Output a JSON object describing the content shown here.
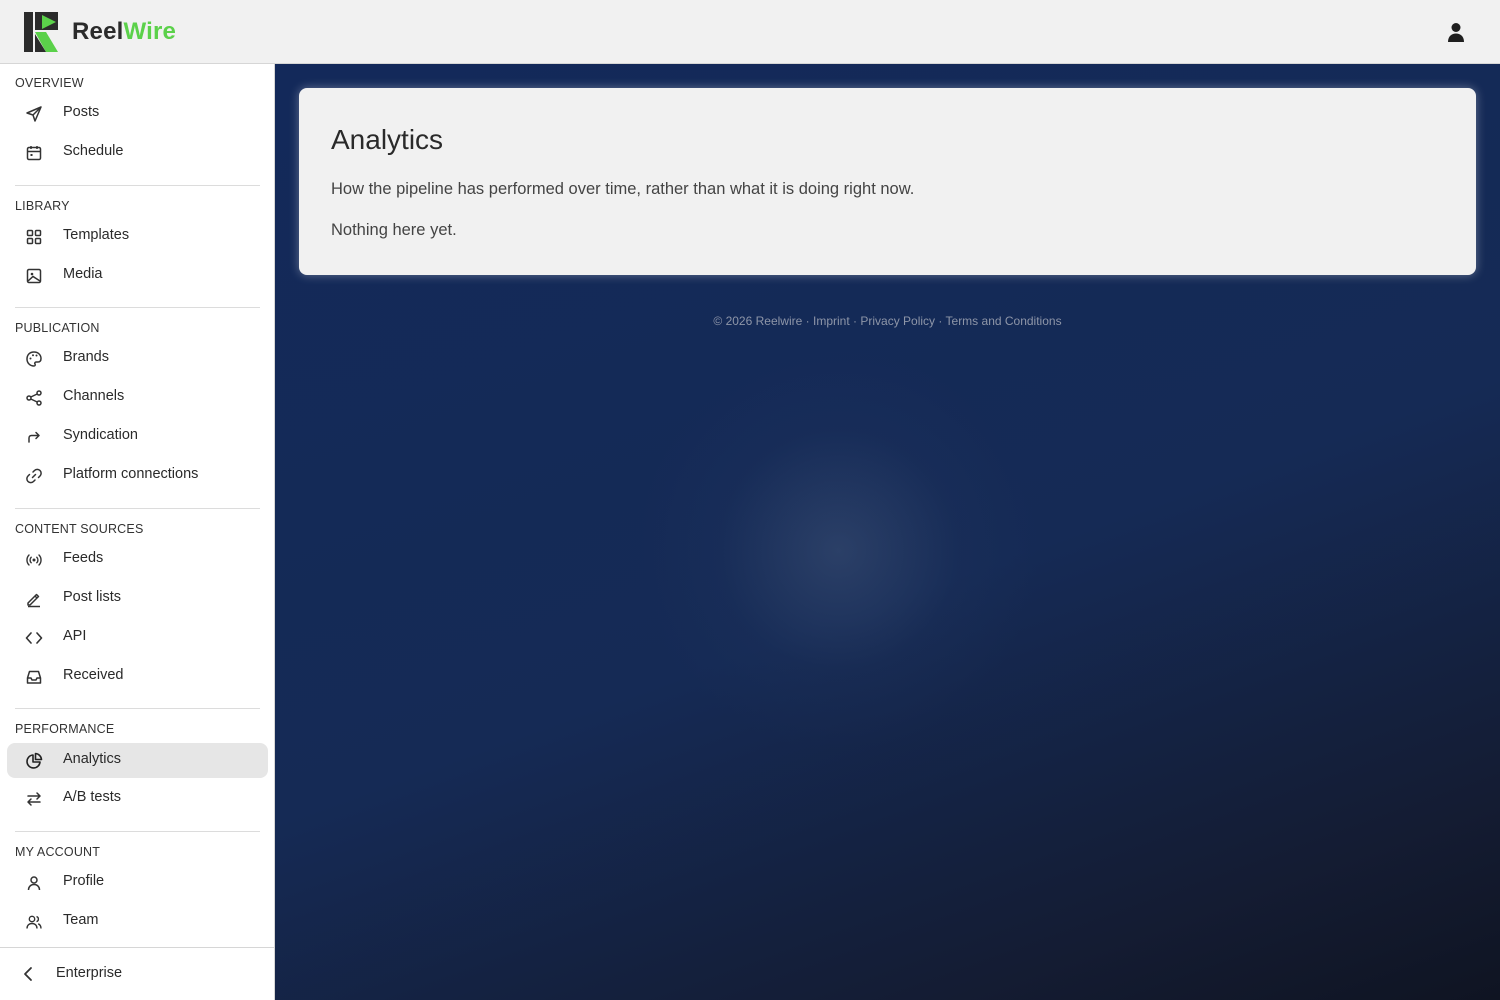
{
  "header": {
    "brand_part1": "Reel",
    "brand_part2": "Wire",
    "brand_colors": {
      "dark": "#2b2b2b",
      "green": "#5bd14a"
    },
    "user_icon": "user-icon"
  },
  "sidebar": {
    "sections": [
      {
        "title": "OVERVIEW",
        "items": [
          {
            "label": "Posts",
            "icon": "send-icon"
          },
          {
            "label": "Schedule",
            "icon": "calendar-icon"
          }
        ]
      },
      {
        "title": "LIBRARY",
        "items": [
          {
            "label": "Templates",
            "icon": "grid-icon"
          },
          {
            "label": "Media",
            "icon": "image-icon"
          }
        ]
      },
      {
        "title": "PUBLICATION",
        "items": [
          {
            "label": "Brands",
            "icon": "palette-icon"
          },
          {
            "label": "Channels",
            "icon": "share-icon"
          },
          {
            "label": "Syndication",
            "icon": "forward-arrow-icon"
          },
          {
            "label": "Platform connections",
            "icon": "link-icon"
          }
        ]
      },
      {
        "title": "CONTENT SOURCES",
        "items": [
          {
            "label": "Feeds",
            "icon": "broadcast-icon"
          },
          {
            "label": "Post lists",
            "icon": "pencil-icon"
          },
          {
            "label": "API",
            "icon": "code-icon"
          },
          {
            "label": "Received",
            "icon": "inbox-icon"
          }
        ]
      },
      {
        "title": "PERFORMANCE",
        "items": [
          {
            "label": "Analytics",
            "icon": "pie-chart-icon",
            "active": true
          },
          {
            "label": "A/B tests",
            "icon": "swap-icon"
          }
        ]
      },
      {
        "title": "MY ACCOUNT",
        "items": [
          {
            "label": "Profile",
            "icon": "user-icon"
          },
          {
            "label": "Team",
            "icon": "users-icon"
          }
        ]
      }
    ],
    "footer": {
      "label": "Enterprise",
      "icon": "chevron-left-icon"
    }
  },
  "main": {
    "title": "Analytics",
    "description": "How the pipeline has performed over time, rather than what it is doing right now.",
    "empty_text": "Nothing here yet."
  },
  "footer": {
    "copyright": "© 2026 Reelwire",
    "sep": "·",
    "links": [
      "Imprint",
      "Privacy Policy",
      "Terms and Conditions"
    ]
  }
}
